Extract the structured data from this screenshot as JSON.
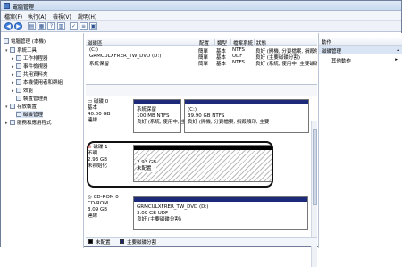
{
  "window": {
    "title": "電腦管理"
  },
  "menu": [
    "檔案(F)",
    "執行(A)",
    "檢視(V)",
    "說明(H)"
  ],
  "tree": [
    {
      "label": "電腦管理 (本機)",
      "icon": "computer-icon",
      "level": 0,
      "exp": ""
    },
    {
      "label": "系統工具",
      "icon": "tools-icon",
      "level": 1,
      "exp": "▾"
    },
    {
      "label": "工作排程器",
      "icon": "scheduler-icon",
      "level": 2,
      "exp": "▸"
    },
    {
      "label": "事件檢視器",
      "icon": "event-viewer-icon",
      "level": 2,
      "exp": "▸"
    },
    {
      "label": "共用資料夾",
      "icon": "shared-folder-icon",
      "level": 2,
      "exp": "▸"
    },
    {
      "label": "本機使用者和群組",
      "icon": "users-icon",
      "level": 2,
      "exp": "▸"
    },
    {
      "label": "效能",
      "icon": "performance-icon",
      "level": 2,
      "exp": "▸"
    },
    {
      "label": "裝置管理員",
      "icon": "device-manager-icon",
      "level": 2,
      "exp": ""
    },
    {
      "label": "存放裝置",
      "icon": "storage-icon",
      "level": 1,
      "exp": "▾"
    },
    {
      "label": "磁碟管理",
      "icon": "disk-management-icon",
      "level": 2,
      "exp": ""
    },
    {
      "label": "服務和應用程式",
      "icon": "services-icon",
      "level": 1,
      "exp": "▸"
    }
  ],
  "volume_list": {
    "headers": [
      "磁碟區",
      "配置",
      "類型",
      "檔案系統",
      "狀態"
    ],
    "rows": [
      [
        "(C:)",
        "簡單",
        "基本",
        "NTFS",
        "良好 (開機, 分頁檔案, 損毀傾印, 主要"
      ],
      [
        "GRMCULXFRER_TW_DVD (D:)",
        "簡單",
        "基本",
        "UDF",
        "良好 (主要磁碟分割)"
      ],
      [
        "系統保留",
        "簡單",
        "基本",
        "NTFS",
        "良好 (系統, 使用中, 主要磁碟分割)"
      ]
    ]
  },
  "disks": [
    {
      "name": "磁碟 0",
      "type": "基本",
      "size": "40.00 GB",
      "status": "連線",
      "partitions": [
        {
          "title": "系統保留",
          "line2": "100 MB NTFS",
          "line3": "良好 (系統, 使用中, 主要磁"
        },
        {
          "title": "(C:)",
          "line2": "39.90 GB NTFS",
          "line3": "良好 (開機, 分頁檔案, 損毀傾印, 主要"
        }
      ]
    },
    {
      "name": "磁碟 1",
      "type": "不明",
      "size": "2.93 GB",
      "status": "未初始化",
      "partitions": [
        {
          "title": "",
          "line2": "2.93 GB",
          "line3": "未配置"
        }
      ]
    },
    {
      "name": "CD-ROM 0",
      "type": "CD-ROM",
      "size": "3.09 GB",
      "status": "連線",
      "partitions": [
        {
          "title": "GRMCULXFRER_TW_DVD (D:)",
          "line2": "3.09 GB UDF",
          "line3": "良好 (主要磁碟分割)"
        }
      ]
    }
  ],
  "legend": [
    "未配置",
    "主要磁碟分割"
  ],
  "actions": {
    "header": "動作",
    "section": "磁碟管理",
    "more": "其他動作"
  },
  "colors": {
    "primary_partition": "#1d2a7a",
    "unallocated": "#000000"
  }
}
